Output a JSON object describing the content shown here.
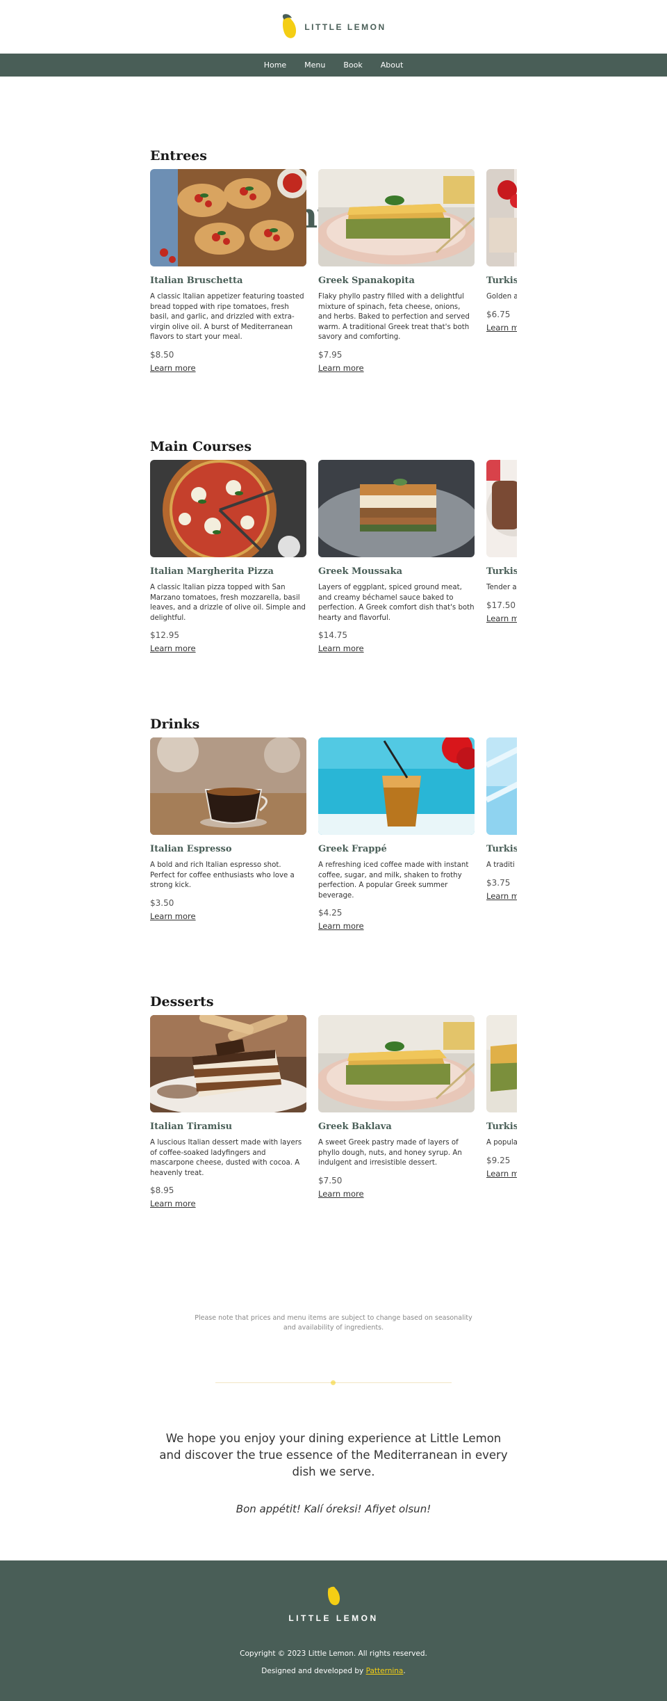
{
  "brand": {
    "name": "LITTLE LEMON",
    "accent": "#f4ce14",
    "primary": "#495e57"
  },
  "nav": [
    "Home",
    "Menu",
    "Book",
    "About"
  ],
  "page_title": "Our Menu",
  "sections": [
    {
      "title": "Entrees",
      "items": [
        {
          "name": "Italian Bruschetta",
          "desc": "A classic Italian appetizer featuring toasted bread topped with ripe tomatoes, fresh basil, and garlic, and drizzled with extra-virgin olive oil. A burst of Mediterranean flavors to start your meal.",
          "price": "$8.50",
          "link": "Learn more",
          "image": "bruschetta"
        },
        {
          "name": "Greek Spanakopita",
          "desc": "Flaky phyllo pastry filled with a delightful mixture of spinach, feta cheese, onions, and herbs. Baked to perfection and served warm. A traditional Greek treat that's both savory and comforting.",
          "price": "$7.95",
          "link": "Learn more",
          "image": "spanakopita"
        },
        {
          "name": "Turkish",
          "desc": "Golden a filled wit parsley. S Turkish c",
          "price": "$6.75",
          "link": "Learn m",
          "image": "turkish-entree"
        }
      ]
    },
    {
      "title": "Main Courses",
      "items": [
        {
          "name": "Italian Margherita Pizza",
          "desc": "A classic Italian pizza topped with San Marzano tomatoes, fresh mozzarella, basil leaves, and a drizzle of olive oil. Simple and delightful.",
          "price": "$12.95",
          "link": "Learn more",
          "image": "pizza"
        },
        {
          "name": "Greek Moussaka",
          "desc": "Layers of eggplant, spiced ground meat, and creamy béchamel sauce baked to perfection. A Greek comfort dish that's both hearty and flavorful.",
          "price": "$14.75",
          "link": "Learn more",
          "image": "moussaka"
        },
        {
          "name": "Turkish",
          "desc": "Tender a marinate with fluff Turkish c",
          "price": "$17.50",
          "link": "Learn m",
          "image": "turkish-main"
        }
      ]
    },
    {
      "title": "Drinks",
      "items": [
        {
          "name": "Italian Espresso",
          "desc": "A bold and rich Italian espresso shot. Perfect for coffee enthusiasts who love a strong kick.",
          "price": "$3.50",
          "link": "Learn more",
          "image": "espresso"
        },
        {
          "name": "Greek Frappé",
          "desc": "A refreshing iced coffee made with instant coffee, sugar, and milk, shaken to frothy perfection. A popular Greek summer beverage.",
          "price": "$4.25",
          "link": "Learn more",
          "image": "frappe"
        },
        {
          "name": "Turkish",
          "desc": "A traditi with yog cool and",
          "price": "$3.75",
          "link": "Learn m",
          "image": "turkish-drink"
        }
      ]
    },
    {
      "title": "Desserts",
      "items": [
        {
          "name": "Italian Tiramisu",
          "desc": "A luscious Italian dessert made with layers of coffee-soaked ladyfingers and mascarpone cheese, dusted with cocoa. A heavenly treat.",
          "price": "$8.95",
          "link": "Learn more",
          "image": "tiramisu"
        },
        {
          "name": "Greek Baklava",
          "desc": "A sweet Greek pastry made of layers of phyllo dough, nuts, and honey syrup. An indulgent and irresistible dessert.",
          "price": "$7.50",
          "link": "Learn more",
          "image": "spanakopita"
        },
        {
          "name": "Turkish",
          "desc": "A popula shredded syrup. Se crushed",
          "price": "$9.25",
          "link": "Learn m",
          "image": "turkish-dessert"
        }
      ]
    }
  ],
  "note": "Please note that prices and menu items are subject to change based on seasonality and availability of ingredients.",
  "closing": "We hope you enjoy your dining experience at Little Lemon and discover the true essence of the Mediterranean in every dish we serve.",
  "signoff": "Bon appétit! Kalí óreksi! Afiyet olsun!",
  "footer": {
    "brand": "LITTLE LEMON",
    "copyright": "Copyright © 2023 Little Lemon. All rights reserved.",
    "credit_prefix": "Designed and developed by ",
    "credit_link": "Patternina",
    "credit_suffix": "."
  }
}
